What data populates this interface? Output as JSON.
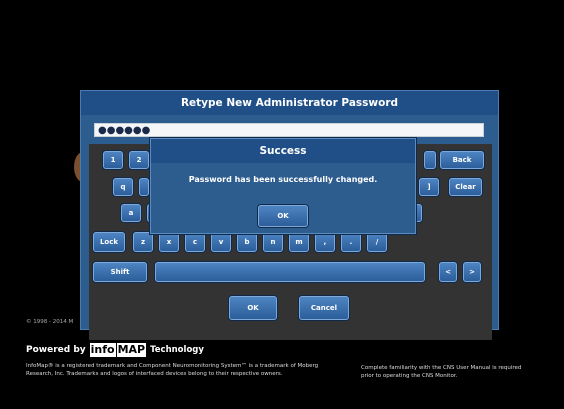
{
  "main_panel": {
    "title": "Retype New Administrator Password",
    "password_mask": "●●●●●●"
  },
  "keyboard": {
    "row1": [
      "1",
      "2"
    ],
    "row1_back": "Back",
    "row2": [
      "q"
    ],
    "row2_right": "]",
    "row2_clear": "Clear",
    "row3": [
      "a"
    ],
    "lock": "Lock",
    "row4": [
      "z",
      "x",
      "c",
      "v",
      "b",
      "n",
      "m",
      ",",
      ".",
      "/"
    ],
    "shift": "Shift",
    "left_arrow": "<",
    "right_arrow": ">"
  },
  "actions": {
    "ok": "OK",
    "cancel": "Cancel"
  },
  "dialog": {
    "title": "Success",
    "message": "Password has been successfully changed.",
    "ok": "OK"
  },
  "footer": {
    "copyright": "© 1998 - 2014 M",
    "powered_by": "Powered by",
    "logo_info": "info",
    "logo_map": "MAP",
    "technology": "Technology",
    "trademark": "InfoMap® is a registered trademark and Component Neuromonitoring System™ is a trademark of Moberg Research, Inc. Trademarks and logos of interfaced devices belong to their respective owners.",
    "notice": "Complete familiarity with the CNS User Manual is required prior to operating the CNS Monitor."
  },
  "colors": {
    "panel": "#2d5c8e",
    "title_bar": "#1f4f86",
    "key_top": "#4d84c2",
    "key_bottom": "#2c5e9a"
  }
}
